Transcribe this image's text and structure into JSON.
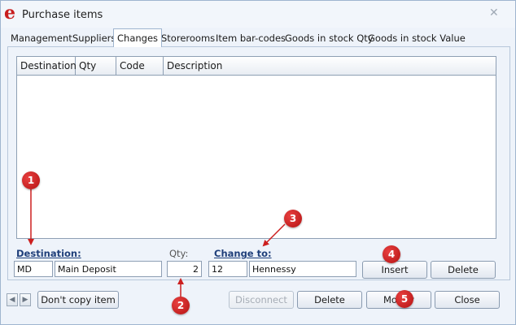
{
  "window": {
    "title": "Purchase items",
    "logo_letter": "e",
    "close_glyph": "✕"
  },
  "tabs": [
    {
      "label": "Management",
      "active": false
    },
    {
      "label": "Suppliers",
      "active": false
    },
    {
      "label": "Changes",
      "active": true
    },
    {
      "label": "Storerooms",
      "active": false
    },
    {
      "label": "Item bar-codes",
      "active": false
    },
    {
      "label": "Goods in stock Qty",
      "active": false
    },
    {
      "label": "Goods in stock Value",
      "active": false
    }
  ],
  "grid": {
    "columns": [
      "Destination",
      "Qty",
      "Code",
      "Description"
    ],
    "rows": []
  },
  "form": {
    "destination_label": "Destination:",
    "qty_label": "Qty:",
    "change_to_label": "Change to:",
    "destination_code": "MD",
    "destination_name": "Main Deposit",
    "qty_value": "2",
    "change_code": "12",
    "change_description": "Hennessy"
  },
  "buttons": {
    "insert": "Insert",
    "delete_row": "Delete",
    "dont_copy": "Don't copy item",
    "disconnect": "Disconnect",
    "delete": "Delete",
    "modify": "Modify",
    "close": "Close"
  },
  "nav": {
    "prev_glyph": "◀",
    "next_glyph": "▶"
  },
  "callouts": [
    "1",
    "2",
    "3",
    "4",
    "5"
  ],
  "colors": {
    "callout": "#cc1f1f",
    "accent_link": "#1f3f7a",
    "window_bg": "#eef3fa"
  }
}
